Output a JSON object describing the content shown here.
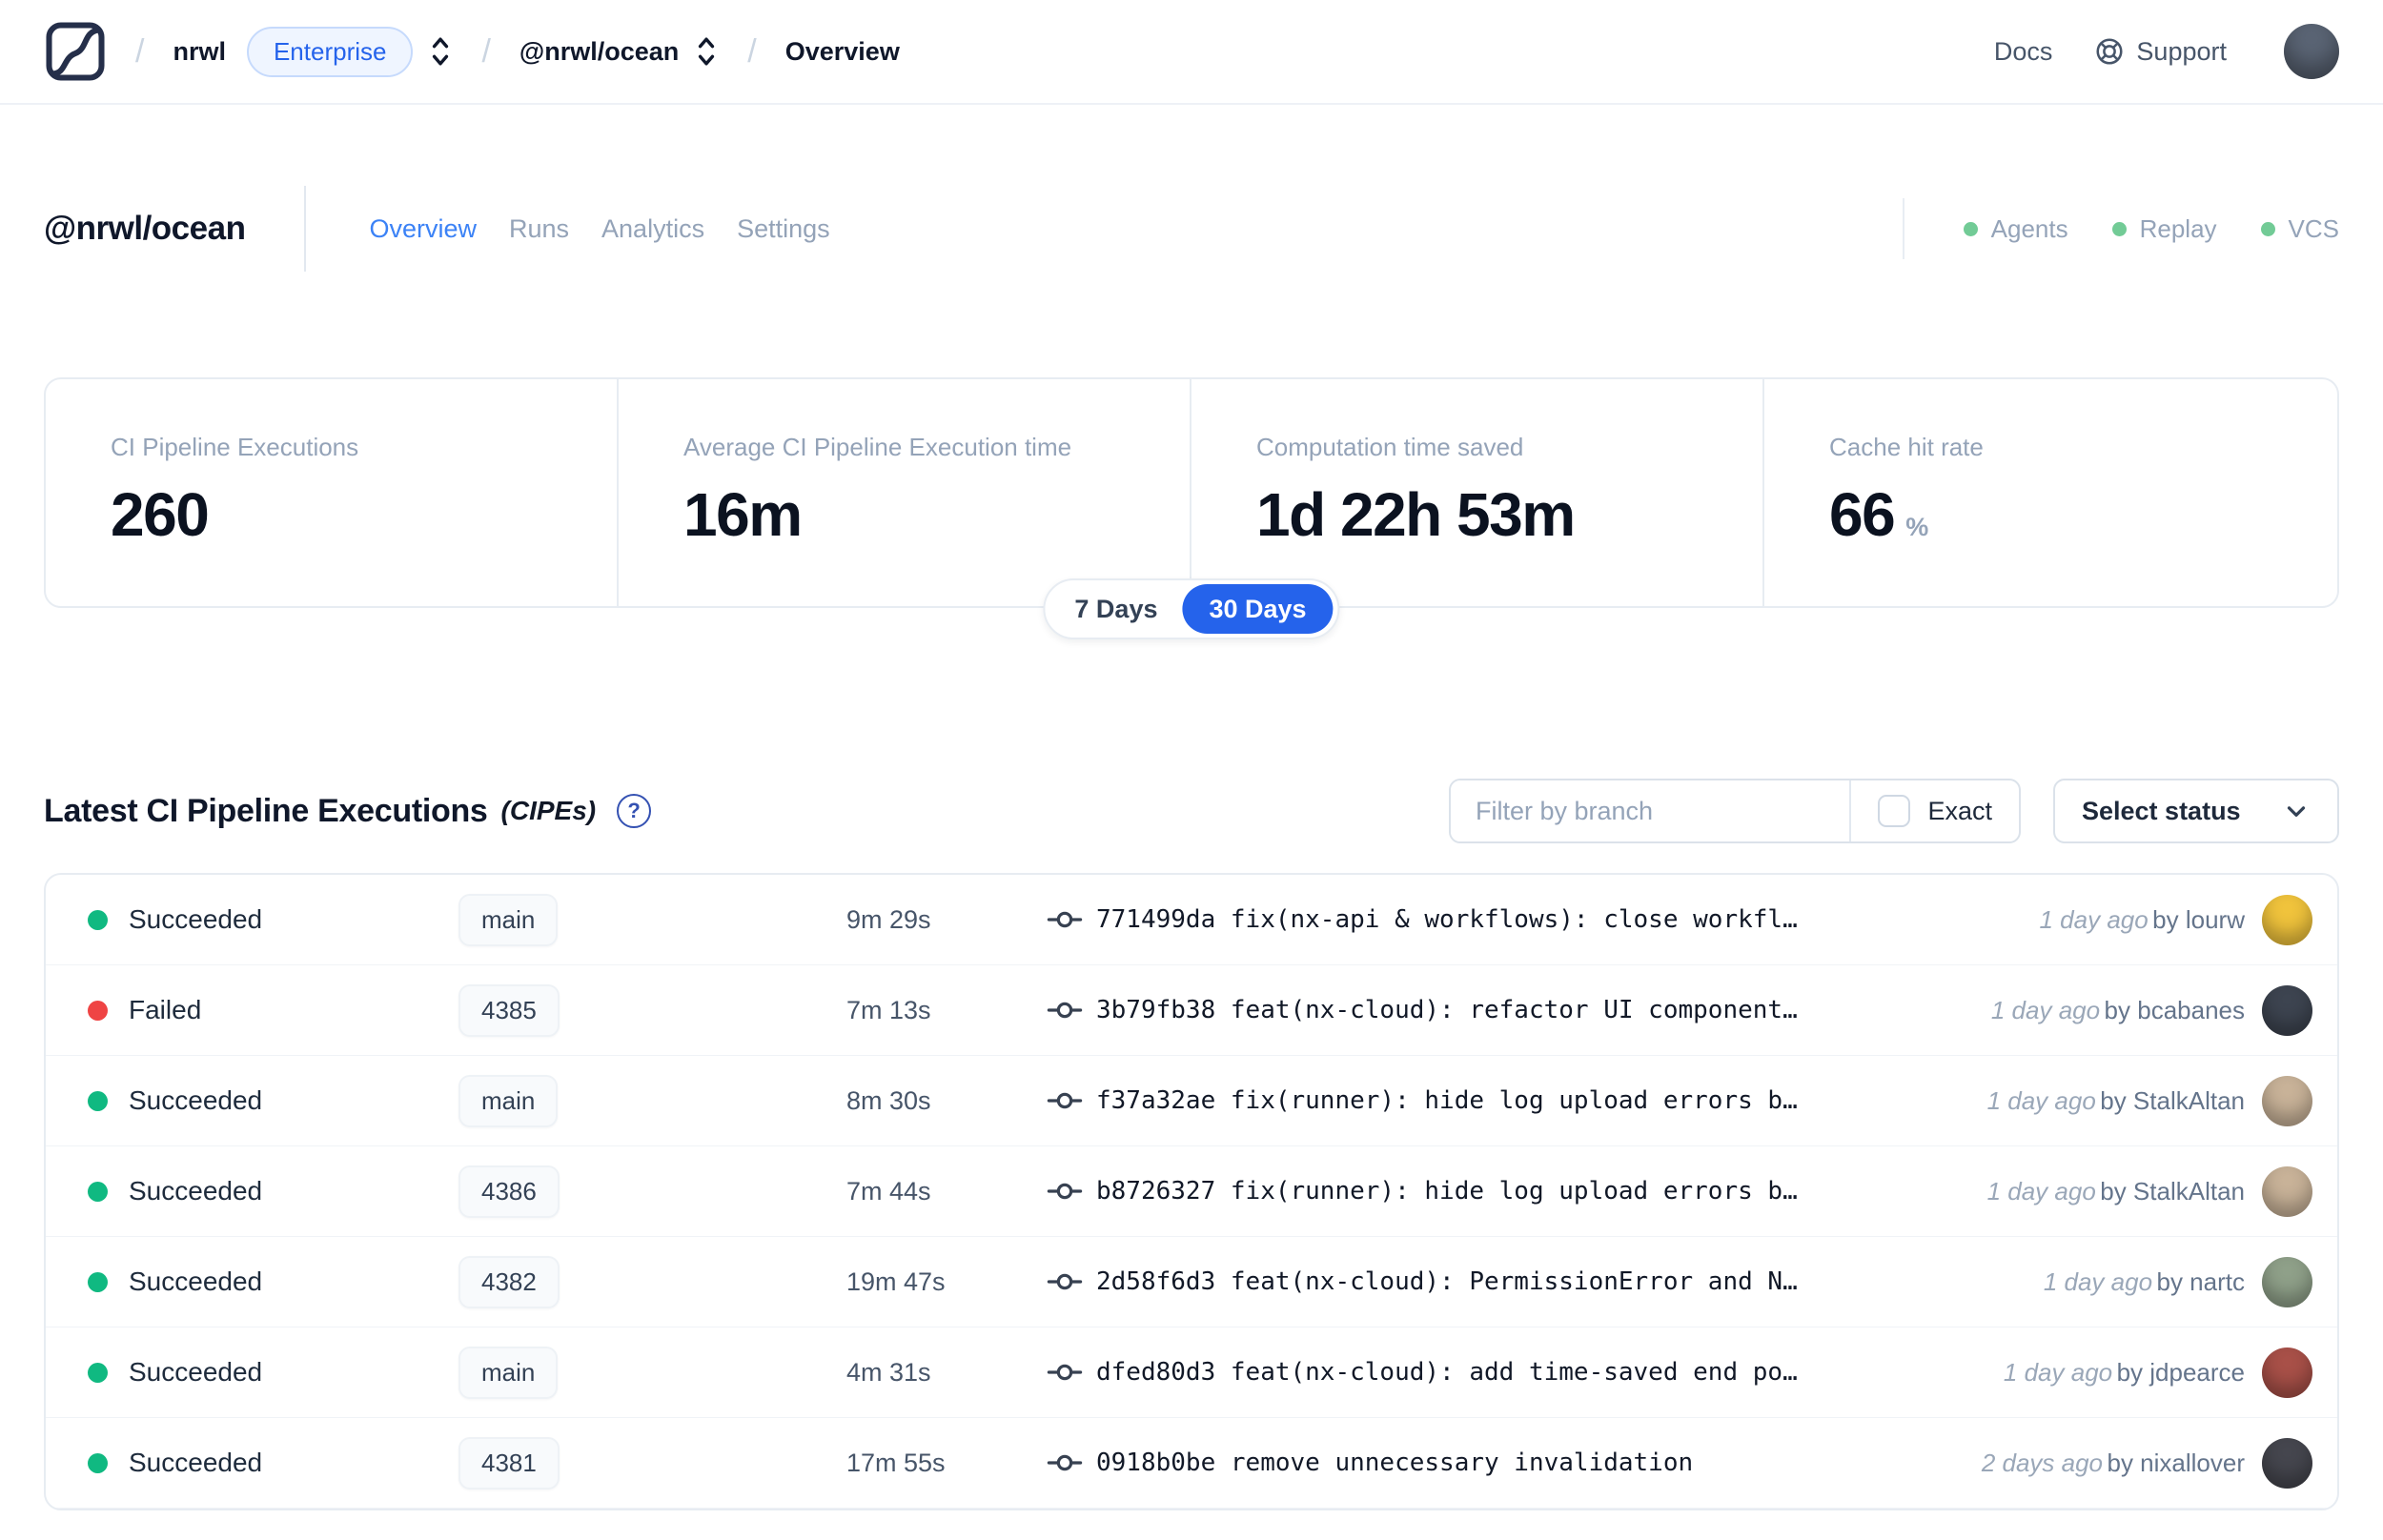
{
  "colors": {
    "accent": "#2563eb",
    "tab_active": "#3b82f6",
    "succeeded": "#10b981",
    "failed": "#ef4444",
    "feature_dot": "#72cb96",
    "navbar_avatar": "#5a6474"
  },
  "navbar": {
    "breadcrumb": {
      "org": "nrwl",
      "org_badge": "Enterprise",
      "workspace": "@nrwl/ocean",
      "page": "Overview"
    },
    "docs_label": "Docs",
    "support_label": "Support"
  },
  "header": {
    "title": "@nrwl/ocean",
    "tabs": [
      {
        "label": "Overview",
        "active": true
      },
      {
        "label": "Runs",
        "active": false
      },
      {
        "label": "Analytics",
        "active": false
      },
      {
        "label": "Settings",
        "active": false
      }
    ],
    "features": [
      {
        "label": "Agents"
      },
      {
        "label": "Replay"
      },
      {
        "label": "VCS"
      }
    ]
  },
  "stats": {
    "cards": [
      {
        "label": "CI Pipeline Executions",
        "value": "260",
        "suffix": ""
      },
      {
        "label": "Average CI Pipeline Execution time",
        "value": "16m",
        "suffix": ""
      },
      {
        "label": "Computation time saved",
        "value": "1d 22h 53m",
        "suffix": ""
      },
      {
        "label": "Cache hit rate",
        "value": "66",
        "suffix": "%"
      }
    ],
    "range_toggle": {
      "options": [
        "7 Days",
        "30 Days"
      ],
      "selected": "30 Days"
    }
  },
  "cipes": {
    "title": "Latest CI Pipeline Executions",
    "title_suffix": "(CIPEs)",
    "filter": {
      "placeholder": "Filter by branch",
      "exact_label": "Exact",
      "status_label": "Select status"
    },
    "rows": [
      {
        "status": "Succeeded",
        "branch": "main",
        "duration": "9m 29s",
        "commit": "771499da",
        "message": "fix(nx-api & workflows): close workfl…",
        "time": "1 day ago",
        "author": "by lourw",
        "avatar_color": "#f0c33c"
      },
      {
        "status": "Failed",
        "branch": "4385",
        "duration": "7m 13s",
        "commit": "3b79fb38",
        "message": "feat(nx-cloud): refactor UI component…",
        "time": "1 day ago",
        "author": "by bcabanes",
        "avatar_color": "#3d4450"
      },
      {
        "status": "Succeeded",
        "branch": "main",
        "duration": "8m 30s",
        "commit": "f37a32ae",
        "message": "fix(runner): hide log upload errors b…",
        "time": "1 day ago",
        "author": "by StalkAltan",
        "avatar_color": "#c8b298"
      },
      {
        "status": "Succeeded",
        "branch": "4386",
        "duration": "7m 44s",
        "commit": "b8726327",
        "message": "fix(runner): hide log upload errors b…",
        "time": "1 day ago",
        "author": "by StalkAltan",
        "avatar_color": "#c8b298"
      },
      {
        "status": "Succeeded",
        "branch": "4382",
        "duration": "19m 47s",
        "commit": "2d58f6d3",
        "message": "feat(nx-cloud): PermissionError and N…",
        "time": "1 day ago",
        "author": "by nartc",
        "avatar_color": "#8fa089"
      },
      {
        "status": "Succeeded",
        "branch": "main",
        "duration": "4m 31s",
        "commit": "dfed80d3",
        "message": "feat(nx-cloud): add time-saved end po…",
        "time": "1 day ago",
        "author": "by jdpearce",
        "avatar_color": "#a85048"
      },
      {
        "status": "Succeeded",
        "branch": "4381",
        "duration": "17m 55s",
        "commit": "0918b0be",
        "message": "remove unnecessary invalidation",
        "time": "2 days ago",
        "author": "by nixallover",
        "avatar_color": "#45464e"
      }
    ]
  }
}
